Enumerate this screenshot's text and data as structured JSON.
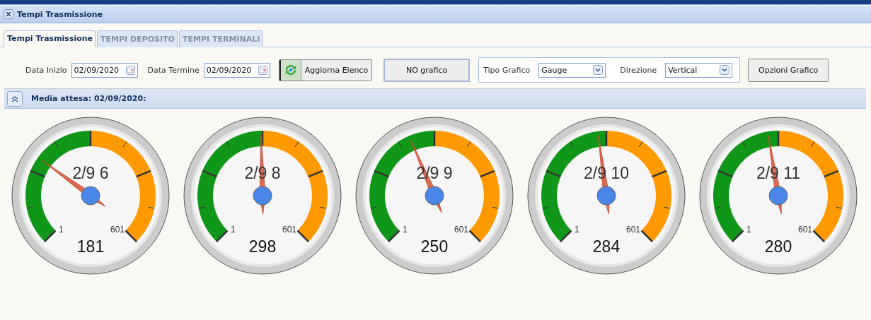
{
  "window": {
    "title": "Tempi Trasmissione"
  },
  "tabs": [
    {
      "label": "Tempi Trasmissione",
      "selected": true
    },
    {
      "label": "TEMPI DEPOSITO",
      "selected": false
    },
    {
      "label": "TEMPI TERMINALI",
      "selected": false
    }
  ],
  "filters": {
    "start_label": "Data Inizio",
    "start_value": "02/09/2020",
    "end_label": "Data Termine",
    "end_value": "02/09/2020",
    "refresh_button": "Aggiorna Elenco"
  },
  "no_chart_button": "NO grafico",
  "chart_settings": {
    "type_label": "Tipo Grafico",
    "type_value": "Gauge",
    "direction_label": "Direzione",
    "direction_value": "Vertical"
  },
  "chart_options_button": "Opzioni Grafico",
  "section": {
    "title": "Media attesa: 02/09/2020:"
  },
  "gauges": [
    {
      "label": "2/9 6",
      "min": "1",
      "max": "601",
      "value": "181",
      "level": 0.3
    },
    {
      "label": "2/9 8",
      "min": "1",
      "max": "601",
      "value": "298",
      "level": 0.495
    },
    {
      "label": "2/9 9",
      "min": "1",
      "max": "601",
      "value": "250",
      "level": 0.415
    },
    {
      "label": "2/9 10",
      "min": "1",
      "max": "601",
      "value": "284",
      "level": 0.472
    },
    {
      "label": "2/9 11",
      "min": "1",
      "max": "601",
      "value": "280",
      "level": 0.465
    }
  ]
}
